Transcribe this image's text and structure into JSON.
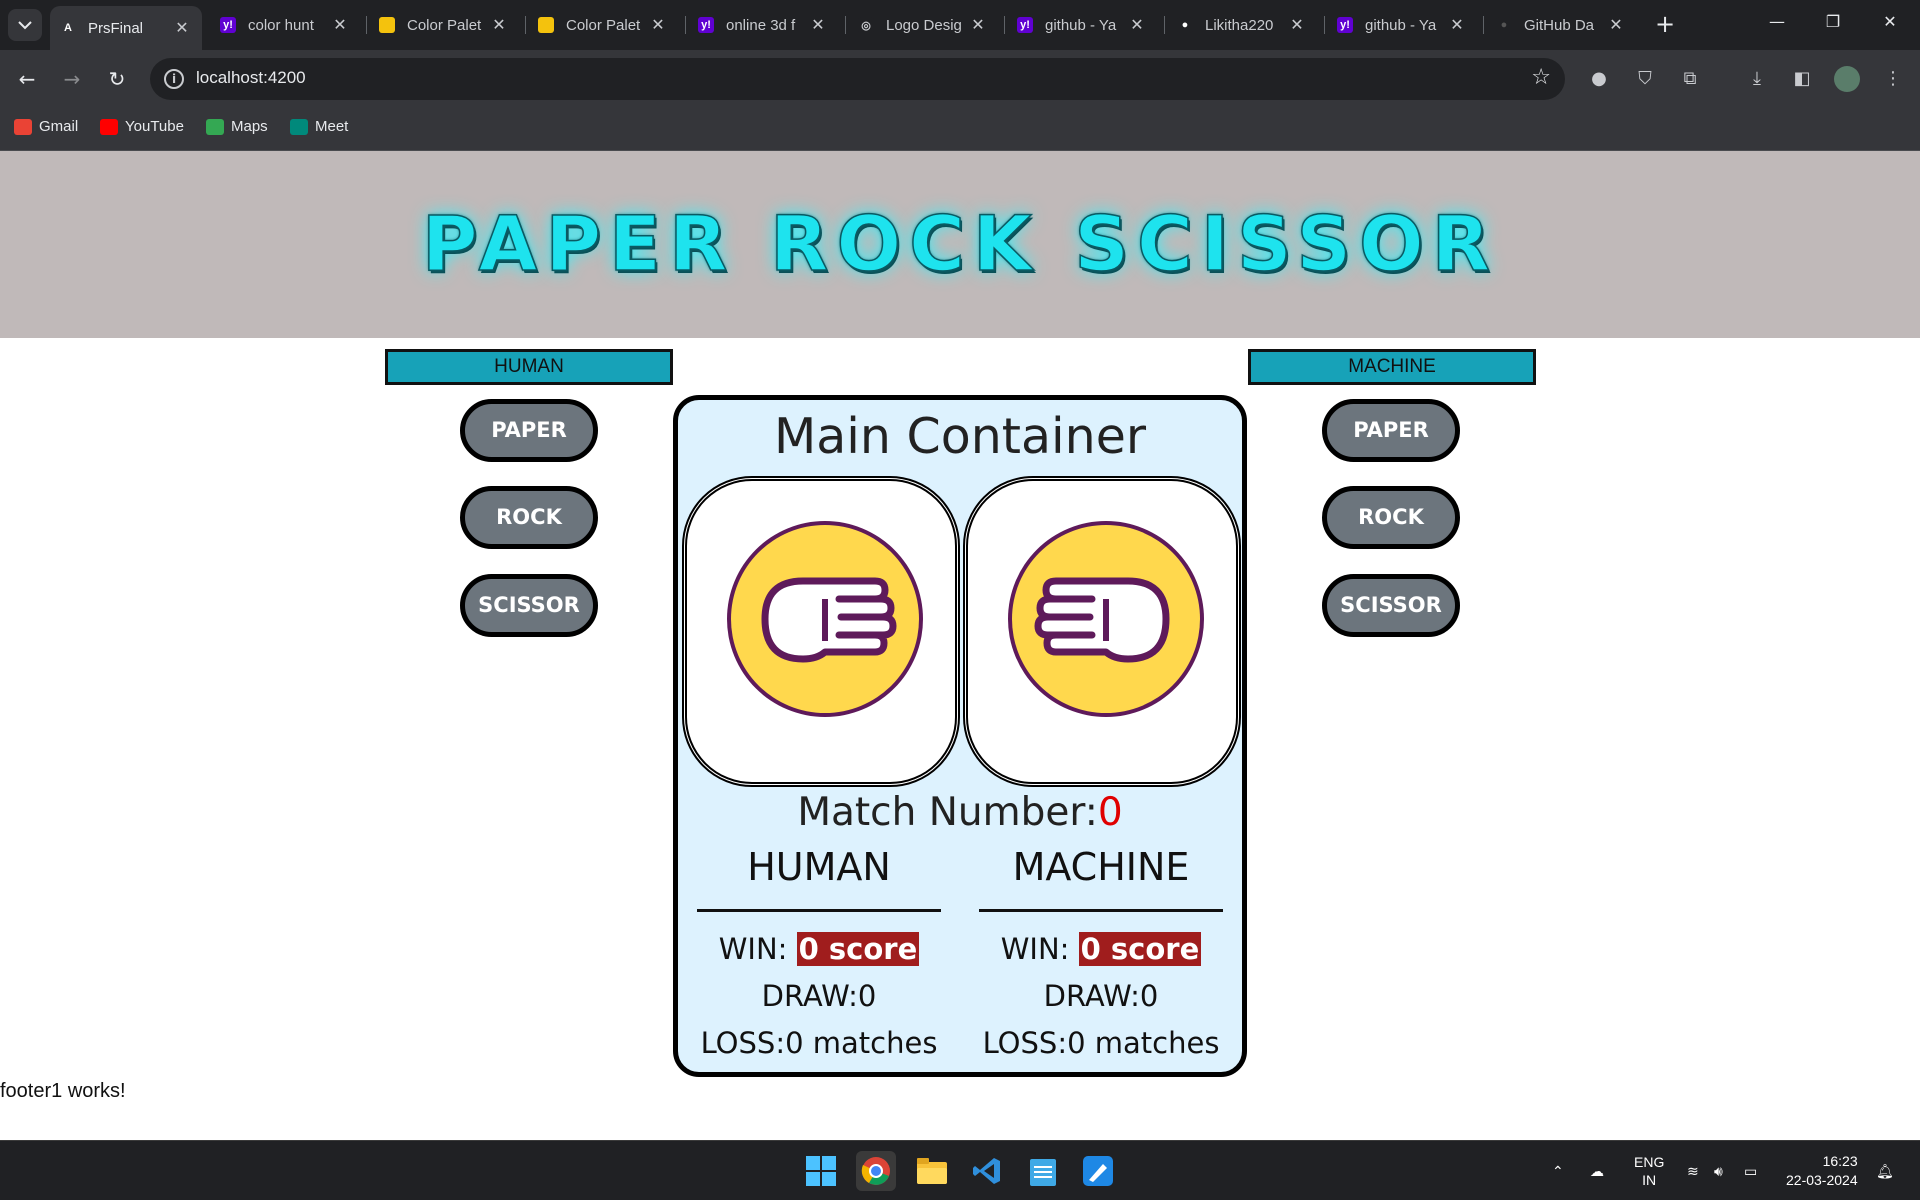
{
  "browser": {
    "tabs": [
      {
        "title": "PrsFinal",
        "fav": "A",
        "favbg": "#35363a",
        "favfg": "#ffffff",
        "active": true
      },
      {
        "title": "color hunt",
        "fav": "y!",
        "favbg": "#6001d2",
        "favfg": "#ffffff"
      },
      {
        "title": "Color Palet",
        "fav": "",
        "favbg": "#f4c20d",
        "favfg": "#000000"
      },
      {
        "title": "Color Palet",
        "fav": "",
        "favbg": "#f4c20d",
        "favfg": "#000000"
      },
      {
        "title": "online 3d f",
        "fav": "y!",
        "favbg": "#6001d2",
        "favfg": "#ffffff"
      },
      {
        "title": "Logo Desig",
        "fav": "◎",
        "favbg": "#202124",
        "favfg": "#c9cbcf"
      },
      {
        "title": "github - Ya",
        "fav": "y!",
        "favbg": "#6001d2",
        "favfg": "#ffffff"
      },
      {
        "title": "Likitha220",
        "fav": "●",
        "favbg": "#202124",
        "favfg": "#ffffff"
      },
      {
        "title": "github - Ya",
        "fav": "y!",
        "favbg": "#6001d2",
        "favfg": "#ffffff"
      },
      {
        "title": "GitHub Da",
        "fav": "●",
        "favbg": "#202124",
        "favfg": "#555555"
      }
    ],
    "url": "localhost:4200",
    "bookmarks": [
      {
        "label": "Gmail",
        "color": "#ea4335"
      },
      {
        "label": "YouTube",
        "color": "#ff0000"
      },
      {
        "label": "Maps",
        "color": "#34a853"
      },
      {
        "label": "Meet",
        "color": "#00897b"
      }
    ]
  },
  "app": {
    "title": "PAPER ROCK SCISSOR",
    "human_label": "HUMAN",
    "machine_label": "MACHINE",
    "choices": [
      "PAPER",
      "ROCK",
      "SCISSOR"
    ],
    "main_title": "Main Container",
    "match_label": "Match Number:",
    "match_number": "0",
    "human": {
      "heading": "HUMAN",
      "win_label": "WIN:",
      "win_value": "0 score",
      "draw": "DRAW:0",
      "loss": "LOSS:0 matches"
    },
    "machine": {
      "heading": "MACHINE",
      "win_label": "WIN:",
      "win_value": "0 score",
      "draw": "DRAW:0",
      "loss": "LOSS:0 matches"
    },
    "footer": "footer1 works!"
  },
  "taskbar": {
    "lang_line1": "ENG",
    "lang_line2": "IN",
    "time": "16:23",
    "date": "22-03-2024"
  },
  "colors": {
    "accent_teal": "#17a2b8",
    "button_gray": "#6c757d",
    "container_bg": "#ddf2fe",
    "score_red": "#a01d1d",
    "banner_bg": "#c0b9b9",
    "title_cyan": "#1ee3ee"
  }
}
